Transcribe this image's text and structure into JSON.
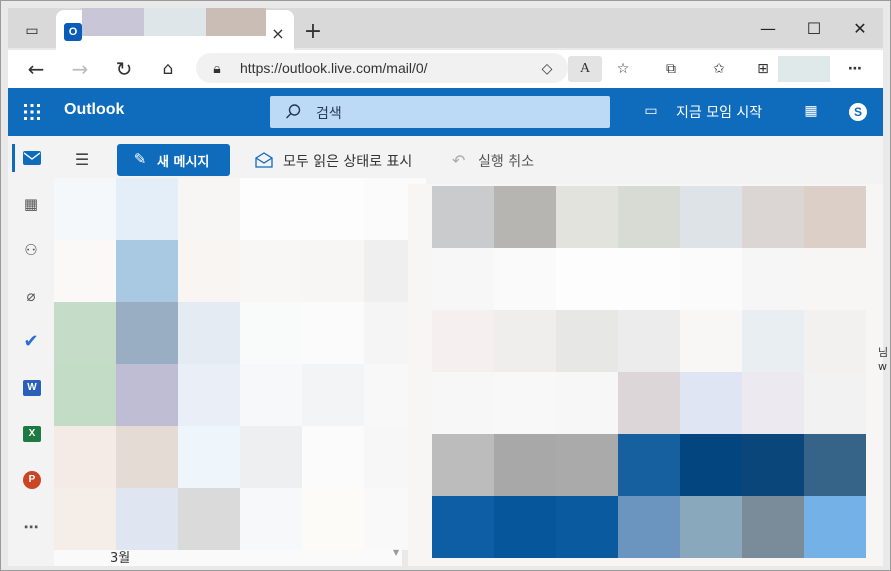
{
  "browser": {
    "tab": {
      "title": "",
      "favicon": "outlook-icon"
    },
    "tab_close": "×",
    "new_tab": "+",
    "window_controls": {
      "minimize": "—",
      "maximize": "☐",
      "close": "✕"
    },
    "url": "https://outlook.live.com/mail/0/",
    "toolbar_icons": [
      "back-icon",
      "forward-icon",
      "refresh-icon",
      "home-icon",
      "lock-icon",
      "reading-view-icon",
      "read-aloud-icon",
      "add-favorite-icon",
      "extensions-icon",
      "favorites-icon",
      "collections-icon",
      "profile-icon",
      "more-icon"
    ]
  },
  "outlook": {
    "brand": "Outlook",
    "search_placeholder": "검색",
    "meet_now": "지금 모임 시작",
    "new_message": "새 메시지",
    "mark_all_read": "모두 읽은 상태로 표시",
    "undo": "실행 취소",
    "month_header": "3월",
    "reading_pane_fragments": [
      "님",
      "w"
    ]
  },
  "colors": {
    "accent": "#0f6cbd",
    "search_bg": "#bcdaf6"
  }
}
